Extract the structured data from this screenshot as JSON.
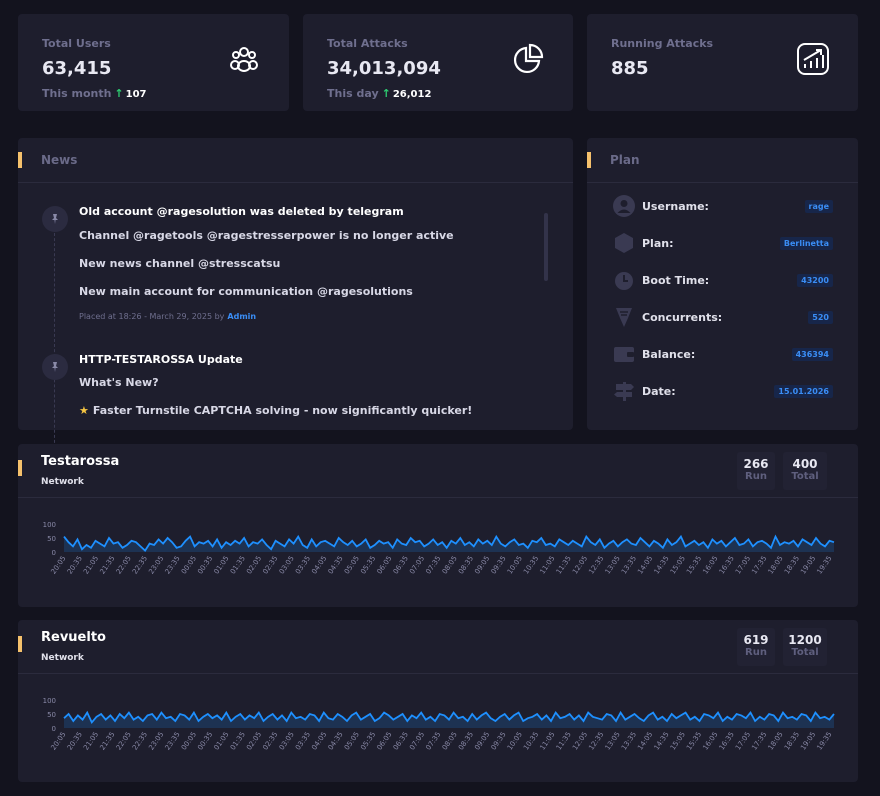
{
  "stats": [
    {
      "label": "Total Users",
      "value": "63,415",
      "sub_label": "This month",
      "sub_value": "107",
      "icon": "users-icon"
    },
    {
      "label": "Total Attacks",
      "value": "34,013,094",
      "sub_label": "This day",
      "sub_value": "26,012",
      "icon": "pie-chart-icon"
    },
    {
      "label": "Running Attacks",
      "value": "885",
      "icon": "trending-up-icon"
    }
  ],
  "news": {
    "title": "News",
    "items": [
      {
        "title": "Old account @ragesolution was deleted by telegram",
        "lines": [
          "Channel  @ragetools @ragestresserpower is no longer active",
          "New news channel @stresscatsu",
          "New main account for communication @ragesolutions"
        ],
        "meta": "Placed at 18:26 - March 29, 2025 by",
        "author": "Admin"
      },
      {
        "title": "HTTP-TESTAROSSA Update",
        "lines": [
          "What's New?",
          "Faster Turnstile CAPTCHA solving - now significantly quicker!"
        ]
      }
    ]
  },
  "plan": {
    "title": "Plan",
    "rows": [
      {
        "label": "Username:",
        "value": "rage",
        "icon": "user-icon"
      },
      {
        "label": "Plan:",
        "value": "Berlinetta",
        "icon": "cube-icon"
      },
      {
        "label": "Boot Time:",
        "value": "43200",
        "icon": "clock-icon"
      },
      {
        "label": "Concurrents:",
        "value": "520",
        "icon": "concurrents-icon"
      },
      {
        "label": "Balance:",
        "value": "436394",
        "icon": "wallet-icon"
      },
      {
        "label": "Date:",
        "value": "15.01.2026",
        "icon": "signpost-icon"
      }
    ]
  },
  "networks": [
    {
      "title": "Testarossa",
      "subtitle": "Network",
      "run_value": "266",
      "run_label": "Run",
      "total_value": "400",
      "total_label": "Total"
    },
    {
      "title": "Revuelto",
      "subtitle": "Network",
      "run_value": "619",
      "run_label": "Run",
      "total_value": "1200",
      "total_label": "Total"
    }
  ],
  "chart_data": [
    {
      "type": "area",
      "series_color": "#1e90ff",
      "y_ticks": [
        "100",
        "50",
        "0"
      ],
      "ylim": [
        0,
        100
      ],
      "x_labels": [
        "20:05",
        "20:35",
        "21:05",
        "21:35",
        "22:05",
        "22:35",
        "23:05",
        "23:35",
        "00:05",
        "00:35",
        "01:05",
        "01:35",
        "02:05",
        "02:35",
        "03:05",
        "03:35",
        "04:05",
        "04:35",
        "05:05",
        "05:35",
        "06:05",
        "06:35",
        "07:05",
        "07:35",
        "08:05",
        "08:35",
        "09:05",
        "09:35",
        "10:05",
        "10:35",
        "11:05",
        "11:35",
        "12:05",
        "12:35",
        "13:05",
        "13:35",
        "14:05",
        "14:35",
        "15:05",
        "15:35",
        "16:05",
        "16:35",
        "17:05",
        "17:35",
        "18:05",
        "18:35",
        "19:05",
        "19:35"
      ],
      "values": [
        55,
        35,
        20,
        45,
        10,
        25,
        15,
        40,
        30,
        20,
        50,
        30,
        35,
        15,
        25,
        40,
        35,
        20,
        5,
        30,
        25,
        45,
        30,
        50,
        35,
        15,
        20,
        40,
        55,
        20,
        35,
        30,
        40,
        20,
        45,
        15,
        35,
        25,
        40,
        30,
        50,
        20,
        35,
        30,
        45,
        25,
        10,
        40,
        30,
        20,
        45,
        30,
        55,
        25,
        15,
        45,
        20,
        35,
        40,
        30,
        20,
        50,
        35,
        25,
        40,
        20,
        30,
        45,
        15,
        25,
        40,
        30,
        35,
        15,
        45,
        30,
        25,
        50,
        35,
        40,
        20,
        30,
        45,
        25,
        35,
        15,
        40,
        30,
        50,
        25,
        35,
        20,
        45,
        30,
        40,
        25,
        55,
        30,
        20,
        35,
        45,
        25,
        30,
        15,
        40,
        35,
        50,
        25,
        30,
        20,
        45,
        35,
        25,
        40,
        30,
        20,
        55,
        35,
        25,
        45,
        15,
        30,
        40,
        20,
        35,
        45,
        30,
        25,
        50,
        35,
        20,
        40,
        30,
        15,
        45,
        25,
        35,
        55,
        20,
        30,
        40,
        25,
        35,
        15,
        45,
        30,
        40,
        20,
        35,
        50,
        25,
        30,
        45,
        20,
        35,
        40,
        30,
        15,
        55,
        25,
        35,
        30,
        40,
        20,
        45,
        35,
        25,
        50,
        30,
        20,
        40,
        35
      ]
    },
    {
      "type": "area",
      "series_color": "#1e90ff",
      "y_ticks": [
        "100",
        "50",
        "0"
      ],
      "ylim": [
        0,
        100
      ],
      "x_labels": [
        "20:05",
        "20:35",
        "21:05",
        "21:35",
        "22:05",
        "22:35",
        "23:05",
        "23:35",
        "00:05",
        "00:35",
        "01:05",
        "01:35",
        "02:05",
        "02:35",
        "03:05",
        "03:35",
        "04:05",
        "04:35",
        "05:05",
        "05:35",
        "06:05",
        "06:35",
        "07:05",
        "07:35",
        "08:05",
        "08:35",
        "09:05",
        "09:35",
        "10:05",
        "10:35",
        "11:05",
        "11:35",
        "12:05",
        "12:35",
        "13:05",
        "13:35",
        "14:05",
        "14:35",
        "15:05",
        "15:35",
        "16:05",
        "16:35",
        "17:05",
        "17:35",
        "18:05",
        "18:35",
        "19:05",
        "19:35"
      ],
      "values": [
        35,
        50,
        25,
        45,
        30,
        55,
        20,
        40,
        50,
        30,
        45,
        25,
        50,
        35,
        55,
        30,
        40,
        25,
        45,
        50,
        30,
        55,
        35,
        40,
        25,
        50,
        45,
        30,
        55,
        25,
        40,
        50,
        35,
        45,
        30,
        55,
        25,
        40,
        50,
        30,
        45,
        35,
        55,
        25,
        40,
        50,
        30,
        45,
        25,
        55,
        35,
        40,
        30,
        50,
        45,
        25,
        55,
        35,
        30,
        50,
        40,
        25,
        45,
        55,
        30,
        40,
        50,
        25,
        35,
        55,
        45,
        30,
        40,
        50,
        25,
        45,
        35,
        55,
        30,
        40,
        25,
        50,
        45,
        30,
        55,
        35,
        40,
        25,
        50,
        30,
        45,
        55,
        35,
        25,
        40,
        50,
        30,
        45,
        55,
        25,
        35,
        40,
        50,
        30,
        45,
        25,
        55,
        35,
        40,
        50,
        30,
        45,
        25,
        55,
        40,
        35,
        30,
        50,
        45,
        25,
        55,
        30,
        40,
        50,
        35,
        25,
        45,
        55,
        30,
        40,
        25,
        50,
        35,
        45,
        55,
        30,
        40,
        25,
        50,
        45,
        35,
        55,
        25,
        40,
        30,
        50,
        45,
        35,
        55,
        25,
        40,
        30,
        50,
        45,
        25,
        55,
        35,
        40,
        30,
        50,
        45,
        25,
        55,
        35,
        40,
        30,
        50
      ]
    }
  ]
}
